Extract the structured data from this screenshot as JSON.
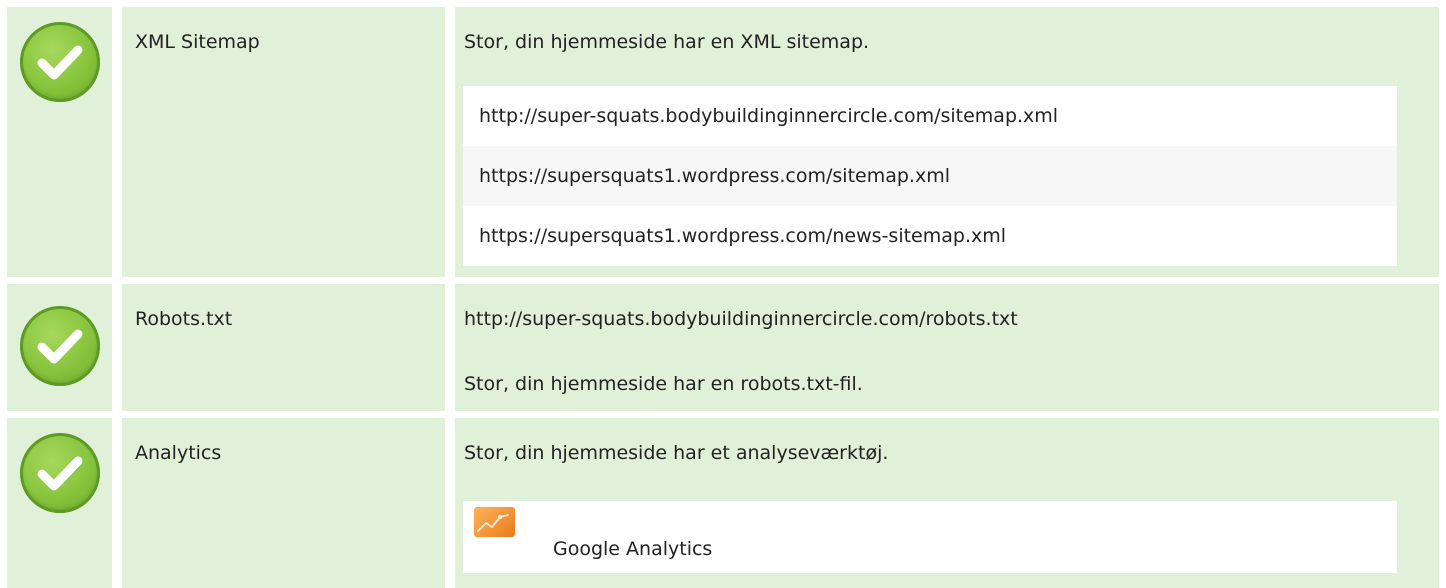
{
  "colors": {
    "row_background": "#e1f0d8",
    "check_green": "#86c33c",
    "list_background": "#ffffff",
    "list_alt_background": "#f7f7f7",
    "analytics_orange": "#f39233"
  },
  "rows": {
    "sitemap": {
      "status_icon": "check-circle-icon",
      "label": "XML Sitemap",
      "message": "Stor, din hjemmeside har en XML sitemap.",
      "urls": [
        "http://super-squats.bodybuildinginnercircle.com/sitemap.xml",
        "https://supersquats1.wordpress.com/sitemap.xml",
        "https://supersquats1.wordpress.com/news-sitemap.xml"
      ]
    },
    "robots": {
      "status_icon": "check-circle-icon",
      "label": "Robots.txt",
      "url": "http://super-squats.bodybuildinginnercircle.com/robots.txt",
      "message": "Stor, din hjemmeside har en robots.txt-fil."
    },
    "analytics": {
      "status_icon": "check-circle-icon",
      "label": "Analytics",
      "message": "Stor, din hjemmeside har et analyseværktøj.",
      "tool_icon": "google-analytics-icon",
      "tool_name": "Google Analytics"
    }
  }
}
